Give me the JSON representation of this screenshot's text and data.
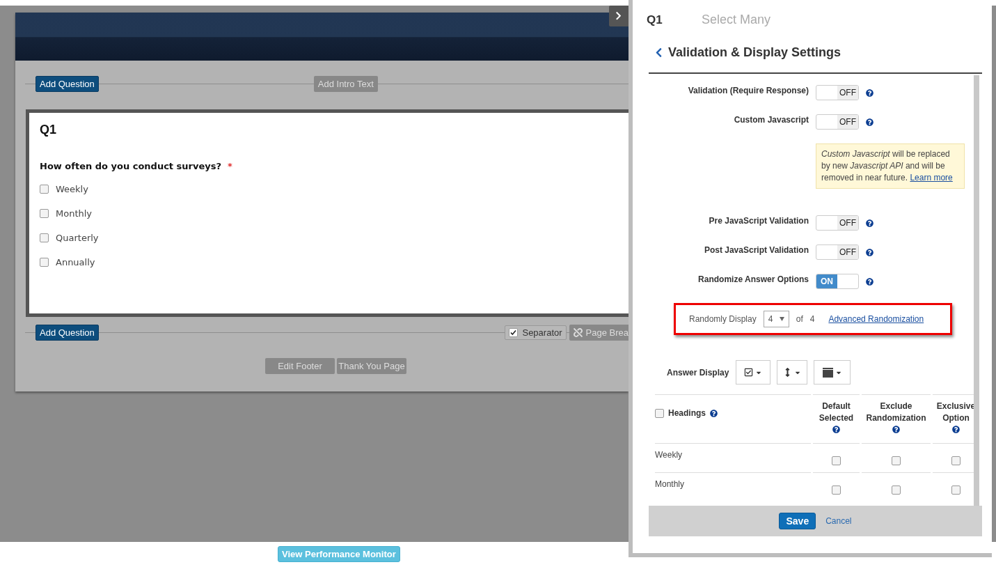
{
  "survey": {
    "top_actions": {
      "add_question": "Add Question",
      "add_intro": "Add Intro Text"
    },
    "question": {
      "number": "Q1",
      "text": "How often do you conduct surveys?",
      "required_mark": "*",
      "options": [
        {
          "label": "Weekly",
          "checked": false
        },
        {
          "label": "Monthly",
          "checked": false
        },
        {
          "label": "Quarterly",
          "checked": false
        },
        {
          "label": "Annually",
          "checked": false
        }
      ]
    },
    "bottom_actions": {
      "add_question": "Add Question",
      "separator": {
        "label": "Separator",
        "checked": true
      },
      "page_break": "Page Brea"
    },
    "footer_buttons": [
      "Edit Footer",
      "Thank You Page"
    ]
  },
  "performance_button": "View Performance Monitor",
  "panel": {
    "question_number": "Q1",
    "question_type": "Select Many",
    "section_title": "Validation & Display Settings",
    "settings": [
      {
        "kind": "toggle",
        "label": "Validation (Require Response)",
        "on": false,
        "state_text": "OFF"
      },
      {
        "kind": "toggle",
        "label": "Custom Javascript",
        "on": false,
        "state_text": "OFF"
      },
      {
        "kind": "notice",
        "text": "*Custom Javascript* will be replaced by new *Javascript API* and will be removed in near future.",
        "link": "Learn more"
      },
      {
        "kind": "toggle",
        "label": "Pre JavaScript Validation",
        "on": false,
        "state_text": "OFF"
      },
      {
        "kind": "toggle",
        "label": "Post JavaScript Validation",
        "on": false,
        "state_text": "OFF"
      },
      {
        "kind": "toggle",
        "label": "Randomize Answer Options",
        "on": true,
        "state_text": "ON"
      }
    ],
    "random_display": {
      "label": "Randomly Display",
      "value": "4",
      "of": "of",
      "total": "4",
      "link": "Advanced Randomization"
    },
    "answer_display": {
      "label": "Answer Display"
    },
    "table": {
      "heading_label": "Headings",
      "heading_checked": false,
      "columns": [
        "Default Selected",
        "Exclude Randomization",
        "Exclusive Option"
      ],
      "rows": [
        {
          "label": "Weekly",
          "cells": [
            {
              "checked": false
            },
            {
              "checked": false
            },
            {
              "checked": false
            }
          ]
        },
        {
          "label": "Monthly",
          "cells": [
            {
              "checked": false
            },
            {
              "checked": false
            },
            {
              "checked": false
            }
          ]
        }
      ]
    },
    "save": "Save",
    "cancel": "Cancel"
  }
}
